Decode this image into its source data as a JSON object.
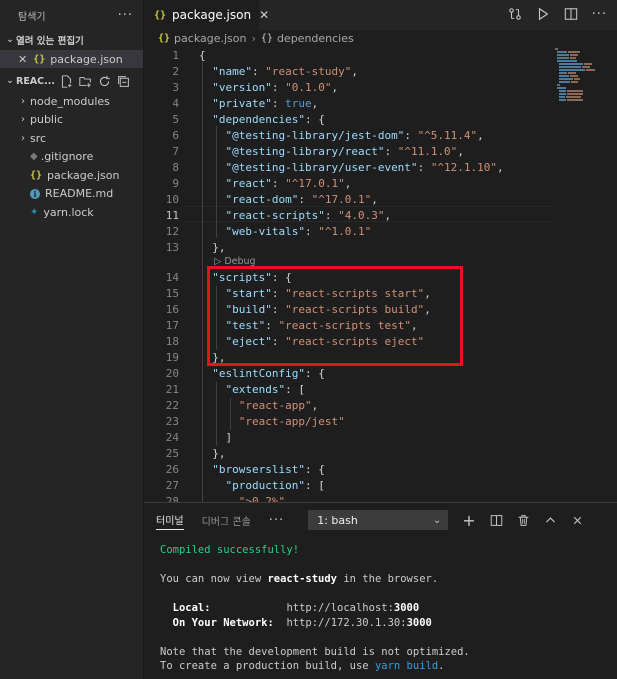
{
  "sidebar": {
    "title": "탐색기",
    "more": "···",
    "open_editors_label": "열려 있는 편집기",
    "open_file": "package.json",
    "project_label": "REAC...",
    "items": [
      {
        "label": "node_modules",
        "type": "folder"
      },
      {
        "label": "public",
        "type": "folder"
      },
      {
        "label": "src",
        "type": "folder"
      },
      {
        "label": ".gitignore",
        "type": "git"
      },
      {
        "label": "package.json",
        "type": "json"
      },
      {
        "label": "README.md",
        "type": "info"
      },
      {
        "label": "yarn.lock",
        "type": "yarn"
      }
    ]
  },
  "tab": {
    "label": "package.json",
    "close": "✕"
  },
  "breadcrumb": {
    "file": "package.json",
    "symbol": "dependencies"
  },
  "editor": {
    "codelens": "▷ Debug"
  },
  "panel": {
    "tabs": [
      "터미널",
      "디버그 콘솔"
    ],
    "more": "···",
    "terminal_select": "1: bash",
    "output": {
      "compiled": "Compiled successfully!",
      "view_prefix": "You can now view ",
      "app_name": "react-study",
      "view_suffix": " in the browser.",
      "local_label": "  Local:",
      "local_pad": "            ",
      "local_url": "http://localhost:",
      "local_port": "3000",
      "network_label": "  On Your Network:",
      "network_pad": "  ",
      "network_url": "http://172.30.1.30:",
      "network_port": "3000",
      "note1": "Note that the development build is not optimized.",
      "note2_prefix": "To create a production build, use ",
      "note2_cmd": "yarn build",
      "note2_suffix": "."
    }
  },
  "colors": {
    "highlight_box": "#e81123",
    "accent": "#007acc"
  }
}
